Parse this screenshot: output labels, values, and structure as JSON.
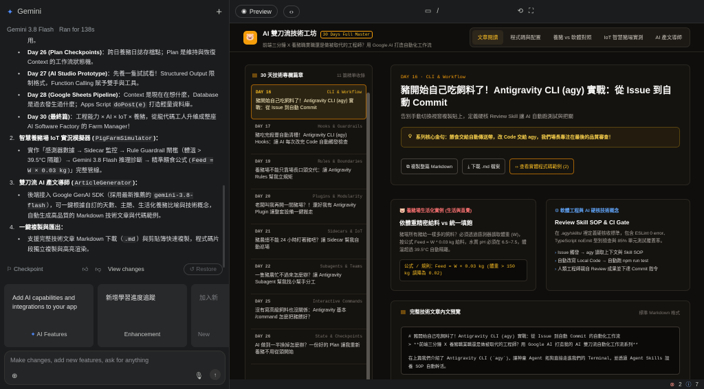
{
  "app": {
    "title": "Gemini",
    "model": "Gemini 3.8 Flash",
    "ran": "Ran for 138s"
  },
  "chat": {
    "l1": "用。",
    "d26_title": "Day 26 (Plan Checkpoints)",
    "d26_text": "：跨日養豬日誌存檔點；Plan 是維持與恢復 Context 的工作流狀態機。",
    "d27_title": "Day 27 (AI Studio Prototype)",
    "d27_text": "：先養一隻試試看！Structured Output 限制格式，Function Calling 賦予雙手與工具。",
    "d28_title": "Day 28 (Google Sheets Pipeline)",
    "d28_text1": "：Context 是現在在想什麼，Database 是過去發生過什麼；Apps Script ",
    "d28_code": "doPost(e)",
    "d28_text2": " 打造輕量資料庫。",
    "d30_title": "Day 30 (最終篇)",
    "d30_text": "：工程能力 × AI × IoT × 養豬，從龍代碼工人升維成整座 AI Software Factory 的 Farm Manager！",
    "s2_num": "2.",
    "s2_title": "智慧養豬場 IoT 實況模擬器 (",
    "s2_code": "PigFarmSimulator",
    "s2_end": ")：",
    "s2_b1": "實作「感測器數據 → Sidecar 監控 → Rule Guardrail 閘檻（體溫 > 39.5°C 隔離）→ Gemini 3.8 Flash 推理診斷 → 精準餵食公式 (",
    "s2_b1code": "Feed = W × 0.03 kg",
    "s2_b1end": ")」完整管線。",
    "s3_num": "3.",
    "s3_title": "雙刀流 AI 產文導師 (",
    "s3_code": "ArticleGenerator",
    "s3_end": ")：",
    "s3_b1a": "後端接入 Google GenAI SDK（採用最新推薦的 ",
    "s3_b1code": "gemini-3.8-flash",
    "s3_b1b": "），可一鍵根據自訂的天數、主題、生活化養豬比喻與技術概念，自動生成高品質的 Markdown 技術文章與代碼範例。",
    "s4_num": "4.",
    "s4_title": "一鍵複製與匯出",
    "s4_end": "：",
    "s4_b1a": "支援完整技術文章 Markdown 下載（",
    "s4_b1code": ".md",
    "s4_b1b": "）與剪貼簿快速複製，程式碼片段獨立複製與高亮渲染。"
  },
  "actions": {
    "checkpoint": "Checkpoint",
    "view_changes": "View changes",
    "restore": "Restore"
  },
  "cards": [
    {
      "text": "Add AI capabilities and integrations to your app",
      "label": "AI Features"
    },
    {
      "text": "新增學習進度追蹤",
      "label": "Enhancement"
    },
    {
      "text": "加入新",
      "label": "New"
    }
  ],
  "input": {
    "placeholder": "Make changes, add new features, ask for anything"
  },
  "topbar": {
    "preview": "Preview",
    "path": "/"
  },
  "site": {
    "title": "AI 雙刀流技術工坊",
    "badge": "30 Days Full Master",
    "subtitle": "前端三分鐘 X 養豬職業職還是做被取代的工程師？用 Google AI 打造自動化工作流",
    "nav": [
      "文章閱讀",
      "程式碼與配置",
      "養豬 vs 軟體對照",
      "IoT 智慧豬場實測",
      "AI 產文導師"
    ]
  },
  "list": {
    "title": "30 天技術專欄篇章",
    "count": "11 篇精華收錄",
    "items": [
      {
        "day": "DAY 16",
        "cat": "CLI & Workflow",
        "title": "豬開始自己吃飼料了！Antigravity CLI (agy) 實戰：從 Issue 到自動 Commit"
      },
      {
        "day": "DAY 17",
        "cat": "Hooks & Guardrails",
        "title": "豬吃完殺豐自動清槽！Antigravity CLI (agy) Hooks：讓 AI 每次改完 Code 自動觸發檢查"
      },
      {
        "day": "DAY 19",
        "cat": "Rules & Boundaries",
        "title": "養豬場不能只靠場長口頭交代：讓 Antigravity Rules 幫我立規矩"
      },
      {
        "day": "DAY 20",
        "cat": "Plugins & Modularity",
        "title": "老闆叫我再開一間豬場？！還好我有 Antigravity Plugin 讓整套設備一鍵搬走"
      },
      {
        "day": "DAY 21",
        "cat": "Sidecars & IoT",
        "title": "豬農總不能 24 小時盯著豬吧？讓 Sidecar 幫我自動巡場"
      },
      {
        "day": "DAY 22",
        "cat": "Subagents & Teams",
        "title": "一隻豬農忙不過來怎麼辦？讓 Antigravity Subagent 幫我找小幫手分工"
      },
      {
        "day": "DAY 25",
        "cat": "Interactive Commands",
        "title": "沒有寫高級飼料也沒關係：Antigravity 基本 /command 怎麼把豬餵好？"
      },
      {
        "day": "DAY 26",
        "cat": "State & Checkpoints",
        "title": "AI 做到一半換掉怎麼辦？一份好的 Plan 讓我重新養豬不用從頭開始"
      }
    ]
  },
  "hero": {
    "tag": "DAY 16 · CLI & Workflow",
    "title": "豬開始自己吃飼料了！Antigravity CLI (agy) 實戰：從 Issue 到自動 Commit",
    "sub": "告別手動切換視窗複製貼上，定義硬核 Review Skill 讓 AI 自動跑測試與把關",
    "quote": "系列核心金句：餵食交給自動傳送帶，改 Code 交給 agy，我們場長專注在最後的品質審查！",
    "btn1": "複製整篇 Markdown",
    "btn2": "下載 .md 檔案",
    "btn3": "查看實體程式碼範例 (2)"
  },
  "life": {
    "label": "養豬場生活化實例 (生活與直覺)",
    "title": "依體重精密給料 vs 統一填飽",
    "body": "豬場所有豬給一樣多的飼料？必須透過感測器讀取體重 (W)，按公式 Feed = W * 0.03 kg 給料，水質 pH 必須在 6.5~7.5，體溫超過 39.5°C 自動隔離。",
    "formula": "公式 / 規則：Feed = W × 0.03 kg (體重 > 150 kg 調降為 0.02)"
  },
  "tech": {
    "label": "軟體工程與 AI 硬核技術概念",
    "title": "Review Skill SOP & CI Gate",
    "body": "在 .agy/skills/ 裡定義硬核收標準，包含 ESLint 0 error、TypeScript noEmit 型別檢查與 85% 單元測試覆蓋率。",
    "bullets": [
      "Issue 觸發 → agy 讀取上下文與 Skill SOP",
      "自動改寫 Local Code → 自動跑 npm run test",
      "人類工程師親自 Review 成果並下達 Commit 指令"
    ]
  },
  "article": {
    "title": "完整技術文章內文預覽",
    "right": "標準 Markdown 格式",
    "lines": [
      "# 豬開始自己吃飼料了！Antigravity CLI (agy) 實戰：從 Issue 到自動 Commit 的自動化工作流",
      "> **前端三分鐘 X 養豬職業職還是做被取代的工程師？用 Google AI 打造我的 AI 雙刀流自動化工作流系列**",
      "",
      "在上篇我們介紹了 Antigravity CLI (`agy`)，讓神童 Agent 拓狗直接走進我們的 Terminal，並透過 Agent Skills 設養 SOP 自動幹活。"
    ]
  },
  "status": {
    "errors": "2",
    "infos": "7"
  }
}
